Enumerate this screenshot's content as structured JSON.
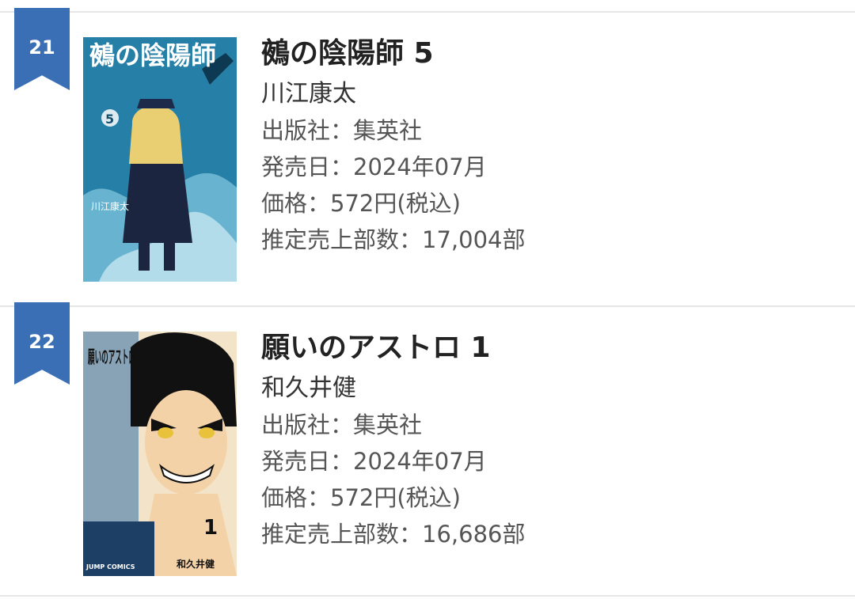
{
  "entries": [
    {
      "rank": "21",
      "title": "鵺の陰陽師 5",
      "author": "川江康太",
      "publisher": "出版社：集英社",
      "release_date": "発売日：2024年07月",
      "price": "価格：572円(税込)",
      "estimated_sales": "推定売上部数：17,004部",
      "cover": {
        "title_text": "鵺の陰陽師",
        "volume": "5",
        "author_text": "川江康太",
        "colors": {
          "primary": "#2b8fb8",
          "dark": "#17506e",
          "light": "#9fe0f2"
        }
      }
    },
    {
      "rank": "22",
      "title": "願いのアストロ 1",
      "author": "和久井健",
      "publisher": "出版社：集英社",
      "release_date": "発売日：2024年07月",
      "price": "価格：572円(税込)",
      "estimated_sales": "推定売上部数：16,686部",
      "cover": {
        "title_text": "願いのアストロ",
        "volume": "1",
        "author_text": "和久井健",
        "imprint": "JUMP COMICS",
        "colors": {
          "primary": "#2f6fa8",
          "dark": "#111111",
          "light": "#f3e3c8"
        }
      }
    }
  ],
  "colors": {
    "rank_badge": "#3a6fb5",
    "divider": "#e6e6e6"
  }
}
